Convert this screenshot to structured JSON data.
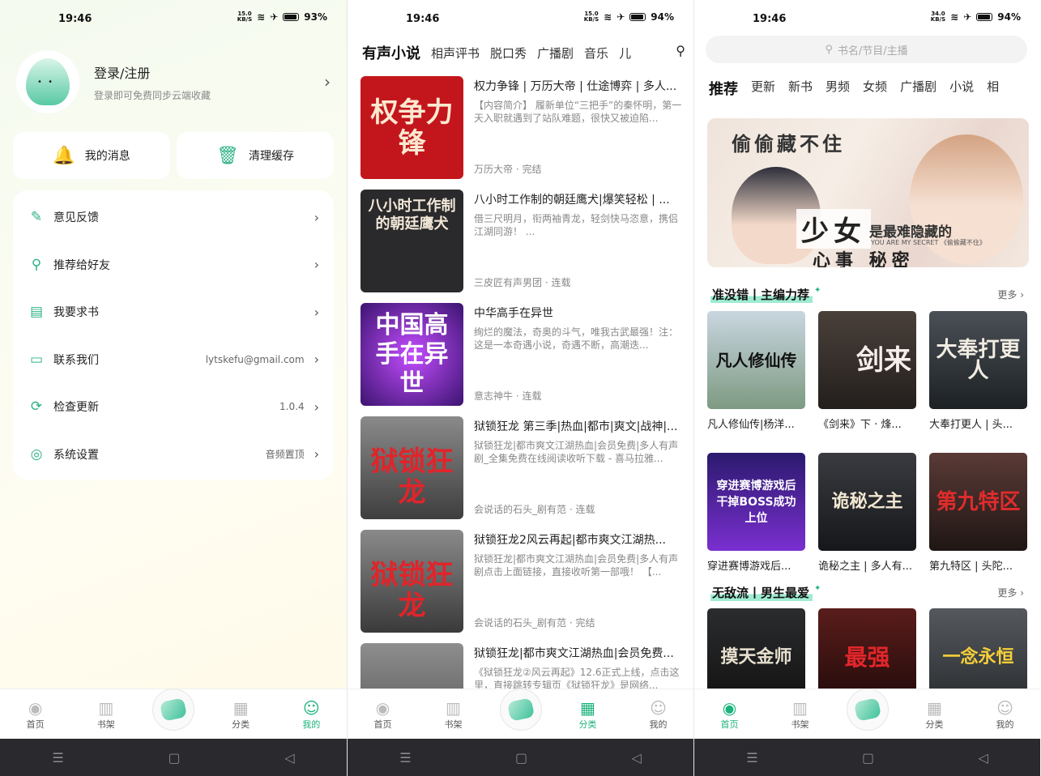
{
  "status": [
    {
      "time": "19:46",
      "speed": "15.0\nKB/S",
      "battery": "93%"
    },
    {
      "time": "19:46",
      "speed": "15.0\nKB/S",
      "battery": "94%"
    },
    {
      "time": "19:46",
      "speed": "34.0\nKB/S",
      "battery": "94%"
    }
  ],
  "profile": {
    "title": "登录/注册",
    "subtitle": "登录即可免费同步云端收藏"
  },
  "quick": [
    {
      "label": "我的消息",
      "icon": "bell-icon"
    },
    {
      "label": "清理缓存",
      "icon": "trash-icon"
    }
  ],
  "settings": [
    {
      "label": "意见反馈",
      "value": "",
      "icon": "edit-icon"
    },
    {
      "label": "推荐给好友",
      "value": "",
      "icon": "share-icon"
    },
    {
      "label": "我要求书",
      "value": "",
      "icon": "book-icon"
    },
    {
      "label": "联系我们",
      "value": "lytskefu@gmail.com",
      "icon": "chat-icon"
    },
    {
      "label": "检查更新",
      "value": "1.0.4",
      "icon": "refresh-icon"
    },
    {
      "label": "系统设置",
      "value": "音频置顶",
      "icon": "gear-icon"
    }
  ],
  "tabbar": [
    "首页",
    "书架",
    "分类",
    "我的"
  ],
  "categories": {
    "tabs": [
      "有声小说",
      "相声评书",
      "脱口秀",
      "广播剧",
      "音乐",
      "儿"
    ],
    "active": 0
  },
  "books": [
    {
      "title": "权力争锋 | 万历大帝 | 仕途博弈 | 多人...",
      "desc": "【内容简介】 履新单位“三把手”的秦怀明，第一天入职就遇到了站队难题，很快又被迫陷...",
      "meta": "万历大帝 · 完结",
      "cover": "权争力锋",
      "bg": "#c3161c",
      "fg": "#fbe9d0"
    },
    {
      "title": "八小时工作制的朝廷鹰犬|爆笑轻松 | ...",
      "desc": "借三尺明月，衔两袖青龙，轻剑快马恣意，携侣江湖同游！ ...",
      "meta": "三皮匠有声男团 · 连载",
      "cover": "八小时工作制的朝廷鹰犬",
      "bg": "#2a2a2c",
      "fg": "#f2e8d8"
    },
    {
      "title": "中华高手在异世",
      "desc": "绚烂的魔法，奇奥的斗气，唯我古武最强！注：这是一本奇遇小说，奇遇不断，高潮迭...",
      "meta": "意志神牛 · 连载",
      "cover": "中国高手在异世",
      "bg": "#5b2a8e",
      "fg": "#ffffff"
    },
    {
      "title": "狱锁狂龙 第三季|热血|都市|爽文|战神|...",
      "desc": "狱锁狂龙|都市爽文江湖热血|会员免费|多人有声剧_全集免费在线阅读收听下载 - 喜马拉雅...",
      "meta": "会说话的石头_剧有范 · 连载",
      "cover": "狱锁狂龙",
      "bg": "#6a6a6a",
      "fg": "#e0242a"
    },
    {
      "title": "狱锁狂龙2风云再起|都市爽文江湖热...",
      "desc": "狱锁狂龙|都市爽文江湖热血|会员免费|多人有声剧点击上面链接，直接收听第一部哦！ 【...",
      "meta": "会说话的石头_剧有范 · 完结",
      "cover": "狱锁狂龙",
      "bg": "#5e5e5e",
      "fg": "#e0242a"
    },
    {
      "title": "狱锁狂龙|都市爽文江湖热血|会员免费...",
      "desc": "《狱锁狂龙②风云再起》12.6正式上线，点击这里，直接跳转专辑页《狱锁狂龙》是网络...",
      "meta": "",
      "cover": "",
      "bg": "#6e6e6e",
      "fg": "#e0242a"
    }
  ],
  "search": {
    "placeholder": "书名/节目/主播"
  },
  "home_tabs": [
    "推荐",
    "更新",
    "新书",
    "男频",
    "女频",
    "广播剧",
    "小说",
    "相"
  ],
  "banner": {
    "title_top": "偷偷藏不住",
    "big": "少女",
    "mid": "是最难隐藏的",
    "sub": "YOU ARE MY SECRET 《偷偷藏不住》",
    "tail": "心事 秘密"
  },
  "sections": [
    {
      "title": "准没错丨主编力荐",
      "more": "更多 ›",
      "items": [
        {
          "title": "凡人修仙传|杨洋...",
          "cover": "凡人修仙传",
          "bg": "#a4b9c9",
          "fg": "#111"
        },
        {
          "title": "《剑来》下 · 烽...",
          "cover": "剑来",
          "bg": "#3a3330",
          "fg": "#f4efe8"
        },
        {
          "title": "大奉打更人 | 头...",
          "cover": "大奉打更人",
          "bg": "#2d3236",
          "fg": "#f1ece2"
        }
      ]
    },
    {
      "title": "",
      "more": "",
      "items": [
        {
          "title": "穿进赛博游戏后...",
          "cover": "穿进赛博游戏后 干掉BOSS成功上位",
          "bg": "#3a1f8a",
          "fg": "#ffffff"
        },
        {
          "title": "诡秘之主 | 多人有...",
          "cover": "诡秘之主",
          "bg": "#26272c",
          "fg": "#f2e7d2"
        },
        {
          "title": "第九特区 | 头陀...",
          "cover": "第九特区",
          "bg": "#3d2320",
          "fg": "#e02c2c"
        }
      ]
    },
    {
      "title": "无敌流丨男生最爱",
      "more": "更多 ›",
      "items": [
        {
          "title": "",
          "cover": "摸天金师",
          "bg": "#1f2022",
          "fg": "#e8e0cf"
        },
        {
          "title": "",
          "cover": "最强",
          "bg": "#3a1413",
          "fg": "#e2262a"
        },
        {
          "title": "",
          "cover": "一念永恒",
          "bg": "#3e4145",
          "fg": "#f6cf3a"
        }
      ]
    }
  ],
  "colors": {
    "accent": "#1bb37b",
    "highlight": "#9eecd2"
  }
}
